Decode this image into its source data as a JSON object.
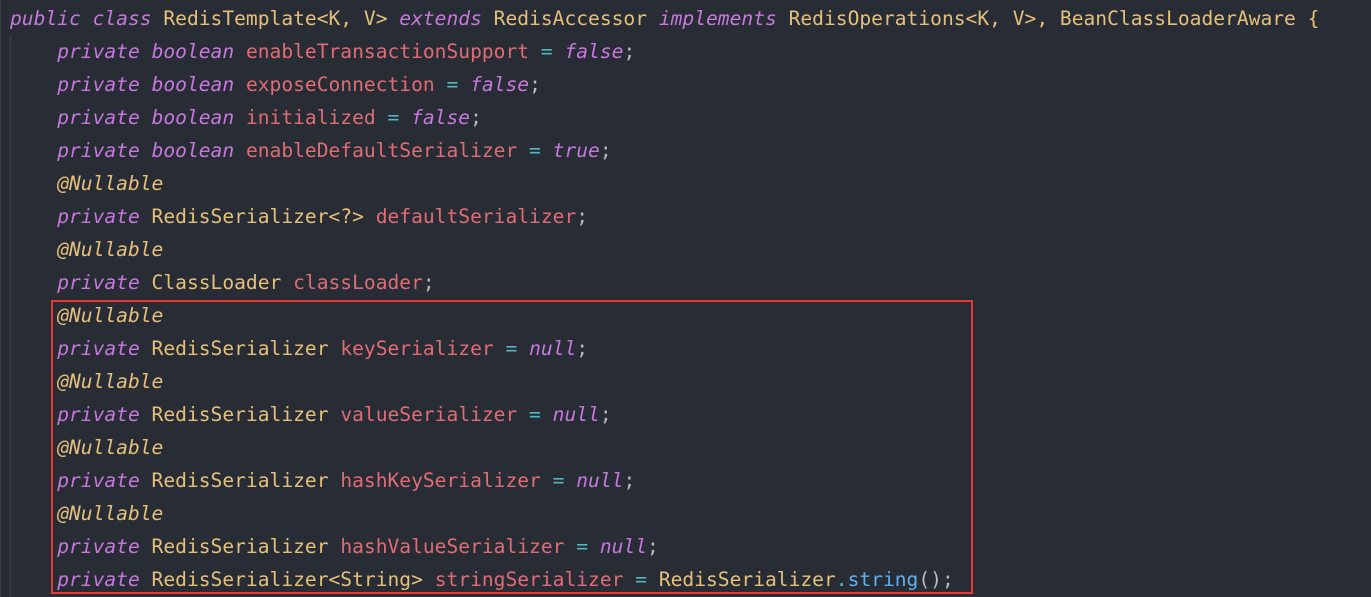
{
  "editor": {
    "lines": [
      {
        "indent": "",
        "tokens": [
          {
            "text": "public",
            "kind": "kw"
          },
          {
            "text": " ",
            "kind": "punc"
          },
          {
            "text": "class",
            "kind": "kw"
          },
          {
            "text": " RedisTemplate<K, V> ",
            "kind": "type"
          },
          {
            "text": "extends",
            "kind": "kw"
          },
          {
            "text": " RedisAccessor ",
            "kind": "type"
          },
          {
            "text": "implements",
            "kind": "kw"
          },
          {
            "text": " RedisOperations<K, V>, BeanClassLoaderAware {",
            "kind": "type"
          }
        ]
      },
      {
        "indent": "    ",
        "tokens": [
          {
            "text": "private",
            "kind": "kw"
          },
          {
            "text": " ",
            "kind": "punc"
          },
          {
            "text": "boolean",
            "kind": "kw"
          },
          {
            "text": " ",
            "kind": "punc"
          },
          {
            "text": "enableTransactionSupport",
            "kind": "field"
          },
          {
            "text": " = ",
            "kind": "op"
          },
          {
            "text": "false",
            "kind": "lit"
          },
          {
            "text": ";",
            "kind": "punc"
          }
        ]
      },
      {
        "indent": "    ",
        "tokens": [
          {
            "text": "private",
            "kind": "kw"
          },
          {
            "text": " ",
            "kind": "punc"
          },
          {
            "text": "boolean",
            "kind": "kw"
          },
          {
            "text": " ",
            "kind": "punc"
          },
          {
            "text": "exposeConnection",
            "kind": "field"
          },
          {
            "text": " = ",
            "kind": "op"
          },
          {
            "text": "false",
            "kind": "lit"
          },
          {
            "text": ";",
            "kind": "punc"
          }
        ]
      },
      {
        "indent": "    ",
        "tokens": [
          {
            "text": "private",
            "kind": "kw"
          },
          {
            "text": " ",
            "kind": "punc"
          },
          {
            "text": "boolean",
            "kind": "kw"
          },
          {
            "text": " ",
            "kind": "punc"
          },
          {
            "text": "initialized",
            "kind": "field"
          },
          {
            "text": " = ",
            "kind": "op"
          },
          {
            "text": "false",
            "kind": "lit"
          },
          {
            "text": ";",
            "kind": "punc"
          }
        ]
      },
      {
        "indent": "    ",
        "tokens": [
          {
            "text": "private",
            "kind": "kw"
          },
          {
            "text": " ",
            "kind": "punc"
          },
          {
            "text": "boolean",
            "kind": "kw"
          },
          {
            "text": " ",
            "kind": "punc"
          },
          {
            "text": "enableDefaultSerializer",
            "kind": "field"
          },
          {
            "text": " = ",
            "kind": "op"
          },
          {
            "text": "true",
            "kind": "lit"
          },
          {
            "text": ";",
            "kind": "punc"
          }
        ]
      },
      {
        "indent": "    ",
        "tokens": [
          {
            "text": "@Nullable",
            "kind": "anno"
          }
        ]
      },
      {
        "indent": "    ",
        "tokens": [
          {
            "text": "private",
            "kind": "kw"
          },
          {
            "text": " RedisSerializer<?> ",
            "kind": "type"
          },
          {
            "text": "defaultSerializer",
            "kind": "field"
          },
          {
            "text": ";",
            "kind": "punc"
          }
        ]
      },
      {
        "indent": "    ",
        "tokens": [
          {
            "text": "@Nullable",
            "kind": "anno"
          }
        ]
      },
      {
        "indent": "    ",
        "tokens": [
          {
            "text": "private",
            "kind": "kw"
          },
          {
            "text": " ClassLoader ",
            "kind": "type"
          },
          {
            "text": "classLoader",
            "kind": "field"
          },
          {
            "text": ";",
            "kind": "punc"
          }
        ]
      },
      {
        "indent": "    ",
        "tokens": [
          {
            "text": "@Nullable",
            "kind": "anno"
          }
        ]
      },
      {
        "indent": "    ",
        "tokens": [
          {
            "text": "private",
            "kind": "kw"
          },
          {
            "text": " RedisSerializer ",
            "kind": "type"
          },
          {
            "text": "keySerializer",
            "kind": "field"
          },
          {
            "text": " = ",
            "kind": "op"
          },
          {
            "text": "null",
            "kind": "lit"
          },
          {
            "text": ";",
            "kind": "punc"
          }
        ]
      },
      {
        "indent": "    ",
        "tokens": [
          {
            "text": "@Nullable",
            "kind": "anno"
          }
        ]
      },
      {
        "indent": "    ",
        "tokens": [
          {
            "text": "private",
            "kind": "kw"
          },
          {
            "text": " RedisSerializer ",
            "kind": "type"
          },
          {
            "text": "valueSerializer",
            "kind": "field"
          },
          {
            "text": " = ",
            "kind": "op"
          },
          {
            "text": "null",
            "kind": "lit"
          },
          {
            "text": ";",
            "kind": "punc"
          }
        ]
      },
      {
        "indent": "    ",
        "tokens": [
          {
            "text": "@Nullable",
            "kind": "anno"
          }
        ]
      },
      {
        "indent": "    ",
        "tokens": [
          {
            "text": "private",
            "kind": "kw"
          },
          {
            "text": " RedisSerializer ",
            "kind": "type"
          },
          {
            "text": "hashKeySerializer",
            "kind": "field"
          },
          {
            "text": " = ",
            "kind": "op"
          },
          {
            "text": "null",
            "kind": "lit"
          },
          {
            "text": ";",
            "kind": "punc"
          }
        ]
      },
      {
        "indent": "    ",
        "tokens": [
          {
            "text": "@Nullable",
            "kind": "anno"
          }
        ]
      },
      {
        "indent": "    ",
        "tokens": [
          {
            "text": "private",
            "kind": "kw"
          },
          {
            "text": " RedisSerializer ",
            "kind": "type"
          },
          {
            "text": "hashValueSerializer",
            "kind": "field"
          },
          {
            "text": " = ",
            "kind": "op"
          },
          {
            "text": "null",
            "kind": "lit"
          },
          {
            "text": ";",
            "kind": "punc"
          }
        ]
      },
      {
        "indent": "    ",
        "tokens": [
          {
            "text": "private",
            "kind": "kw"
          },
          {
            "text": " RedisSerializer<String> ",
            "kind": "type"
          },
          {
            "text": "stringSerializer",
            "kind": "field"
          },
          {
            "text": " = ",
            "kind": "op"
          },
          {
            "text": "RedisSerializer",
            "kind": "type"
          },
          {
            "text": ".",
            "kind": "op"
          },
          {
            "text": "string",
            "kind": "method"
          },
          {
            "text": "();",
            "kind": "punc"
          }
        ]
      }
    ]
  },
  "colors": {
    "background": "#282c34",
    "keyword": "#c678dd",
    "type": "#e5c07b",
    "field": "#e06c75",
    "operator": "#56b6c2",
    "method": "#61afef",
    "highlight_border": "#e53935"
  }
}
